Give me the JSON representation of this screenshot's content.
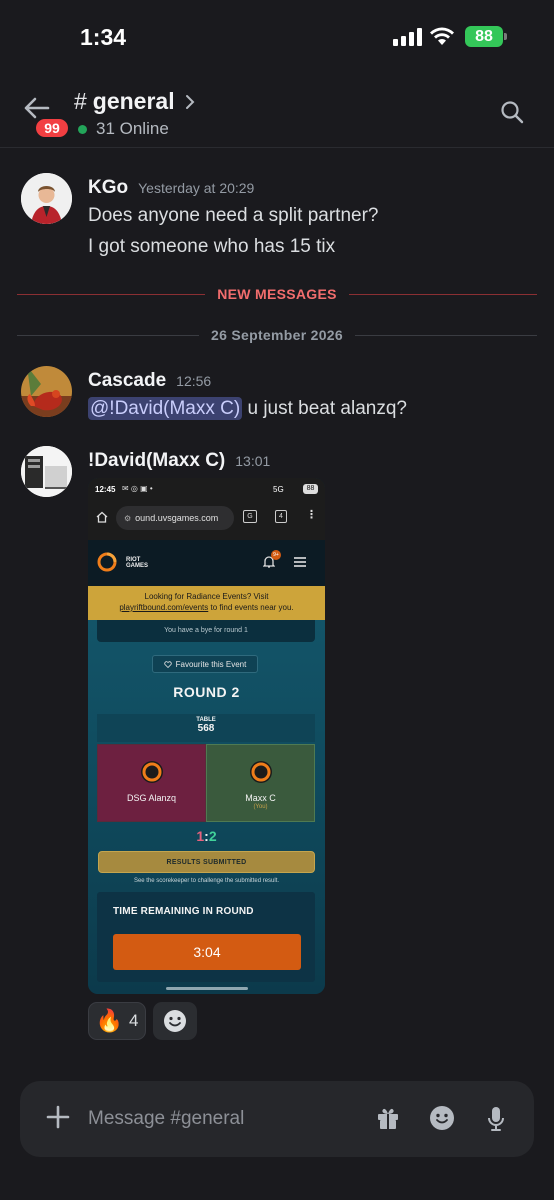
{
  "status_bar": {
    "time": "1:34",
    "battery": "88"
  },
  "header": {
    "channel_hash": "#",
    "channel_name": "general",
    "online_count": "31 Online",
    "unread_badge": "99"
  },
  "messages": [
    {
      "author": "KGo",
      "timestamp": "Yesterday at 20:29",
      "lines": [
        "Does anyone need a split partner?",
        "I got someone who has 15 tix"
      ]
    },
    {
      "author": "Cascade",
      "timestamp": "12:56",
      "mention": "@!David(Maxx C)",
      "text": " u just beat alanzq?"
    },
    {
      "author": "!David(Maxx C)",
      "timestamp": "13:01"
    }
  ],
  "dividers": {
    "new_messages": "NEW MESSAGES",
    "date": "26 September 2026"
  },
  "attachment": {
    "status_time": "12:45",
    "status_right": "5G",
    "battery": "88",
    "url": "ound.uvsgames.com",
    "tab_count": "4",
    "brand": "RIOT GAMES",
    "bell_badge": "9+",
    "banner_line1": "Looking for Radiance Events? Visit",
    "banner_link": "playriftbound.com/events",
    "banner_line2": " to find events near you.",
    "bye_text": "You have a bye for round 1",
    "favourite": "Favourite this Event",
    "round": "ROUND 2",
    "table_label": "TABLE",
    "table_number": "568",
    "player_left": "DSG Alanzq",
    "player_right": "Maxx C",
    "player_right_tag": "(You)",
    "score_left": "1",
    "score_sep": ":",
    "score_right": "2",
    "results": "RESULTS SUBMITTED",
    "results_note": "See the scorekeeper to challenge the submitted result.",
    "timer_label": "TIME REMAINING IN ROUND",
    "timer_value": "3:04"
  },
  "reactions": [
    {
      "emoji": "🔥",
      "count": "4"
    }
  ],
  "composer": {
    "placeholder": "Message #general"
  },
  "colors": {
    "accent_red": "#f23f42",
    "online_green": "#23a55a",
    "new_messages_red": "#f26d6d",
    "timer_orange": "#d35b12"
  }
}
